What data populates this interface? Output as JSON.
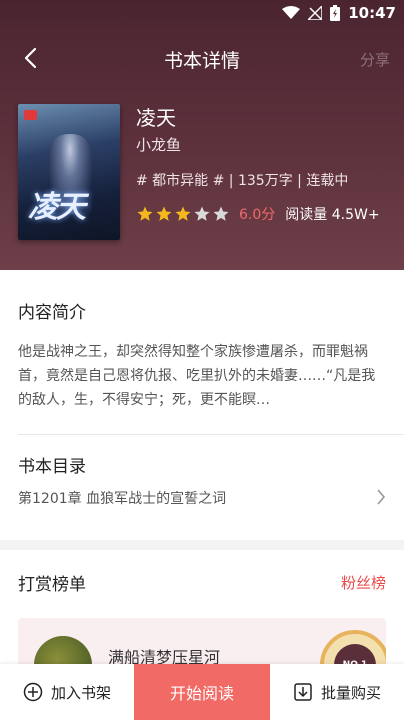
{
  "status_bar": {
    "time": "10:47",
    "icons": [
      "wifi-icon",
      "no-signal-icon",
      "battery-charging-icon"
    ]
  },
  "nav": {
    "title": "书本详情",
    "share_label": "分享",
    "back_icon": "back-arrow-icon"
  },
  "book": {
    "cover_title": "凌天",
    "title": "凌天",
    "author": "小龙鱼",
    "meta": "# 都市异能 # | 135万字 | 连载中",
    "rating": 3,
    "rating_max": 5,
    "score": "6.0分",
    "reads": "阅读量 4.5W+"
  },
  "intro": {
    "title": "内容简介",
    "text": "他是战神之王，却突然得知整个家族惨遭屠杀，而罪魁祸首，竟然是自己恩将仇报、吃里扒外的未婚妻……“凡是我的敌人，生，不得安宁；死，更不能瞑…"
  },
  "catalog": {
    "title": "书本目录",
    "latest_chapter": "第1201章 血狼军战士的宣誓之词"
  },
  "reward": {
    "title": "打赏榜单",
    "fans_link": "粉丝榜",
    "top_user_name": "满船清梦压星河",
    "medal_text": "NO.1"
  },
  "bottom_bar": {
    "add_label": "加入书架",
    "read_label": "开始阅读",
    "buy_label": "批量购买"
  },
  "colors": {
    "header_bg": "#5a2f3a",
    "accent": "#f26a66",
    "star_on": "#f5b81c",
    "star_off": "#d9d9d9",
    "score": "#f06a6a"
  }
}
